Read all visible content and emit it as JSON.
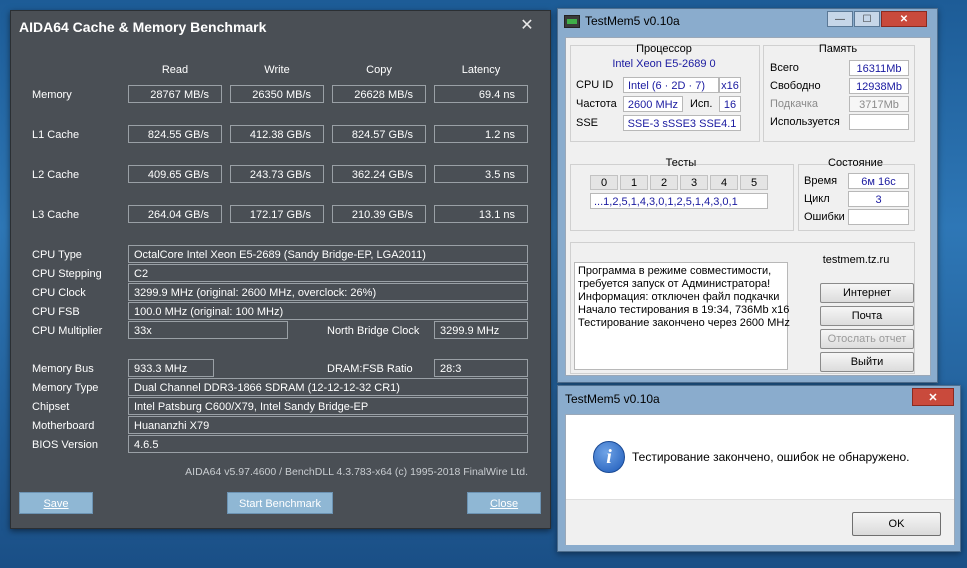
{
  "aida": {
    "title": "AIDA64 Cache & Memory Benchmark",
    "columns": [
      "Read",
      "Write",
      "Copy",
      "Latency"
    ],
    "bench_rows": [
      {
        "label": "Memory",
        "read": "28767 MB/s",
        "write": "26350 MB/s",
        "copy": "26628 MB/s",
        "latency": "69.4 ns"
      },
      {
        "label": "L1 Cache",
        "read": "824.55 GB/s",
        "write": "412.38 GB/s",
        "copy": "824.57 GB/s",
        "latency": "1.2 ns"
      },
      {
        "label": "L2 Cache",
        "read": "409.65 GB/s",
        "write": "243.73 GB/s",
        "copy": "362.24 GB/s",
        "latency": "3.5 ns"
      },
      {
        "label": "L3 Cache",
        "read": "264.04 GB/s",
        "write": "172.17 GB/s",
        "copy": "210.39 GB/s",
        "latency": "13.1 ns"
      }
    ],
    "cpu_type_label": "CPU Type",
    "cpu_type": "OctalCore Intel Xeon E5-2689  (Sandy Bridge-EP, LGA2011)",
    "cpu_stepping_label": "CPU Stepping",
    "cpu_stepping": "C2",
    "cpu_clock_label": "CPU Clock",
    "cpu_clock": "3299.9 MHz  (original: 2600 MHz, overclock: 26%)",
    "cpu_fsb_label": "CPU FSB",
    "cpu_fsb": "100.0 MHz  (original: 100 MHz)",
    "cpu_mult_label": "CPU Multiplier",
    "cpu_mult": "33x",
    "nb_clock_label": "North Bridge Clock",
    "nb_clock": "3299.9 MHz",
    "mem_bus_label": "Memory Bus",
    "mem_bus": "933.3 MHz",
    "dram_ratio_label": "DRAM:FSB Ratio",
    "dram_ratio": "28:3",
    "mem_type_label": "Memory Type",
    "mem_type": "Dual Channel DDR3-1866 SDRAM  (12-12-12-32 CR1)",
    "chipset_label": "Chipset",
    "chipset": "Intel Patsburg C600/X79, Intel Sandy Bridge-EP",
    "mobo_label": "Motherboard",
    "mobo": "Huananzhi X79",
    "bios_label": "BIOS Version",
    "bios": "4.6.5",
    "footer": "AIDA64 v5.97.4600 / BenchDLL 4.3.783-x64  (c) 1995-2018 FinalWire Ltd.",
    "btn_save": "Save",
    "btn_start": "Start Benchmark",
    "btn_close": "Close",
    "close_glyph": "✕"
  },
  "testmem": {
    "title": "TestMem5 v0.10a",
    "win_min": "—",
    "win_max": "☐",
    "win_close": "✕",
    "cpu_group": "Процессор",
    "cpu_name": "Intel Xeon  E5-2689 0",
    "cpuid_label": "CPU ID",
    "cpuid": "Intel  (6 · 2D · 7)",
    "cpuid_threads": "x16",
    "freq_label": "Частота",
    "freq": "2600 MHz",
    "used_label": "Исп.",
    "used": "16",
    "sse_label": "SSE",
    "sse": "SSE-3 sSSE3 SSE4.1",
    "mem_group": "Память",
    "total_label": "Всего",
    "total": "16311Mb",
    "free_label": "Свободно",
    "free": "12938Mb",
    "swap_label": "Подкачка",
    "swap": "3717Mb",
    "inuse_label": "Используется",
    "inuse": "",
    "tests_group": "Тесты",
    "tests": [
      "0",
      "1",
      "2",
      "3",
      "4",
      "5"
    ],
    "tests_seq": "...1,2,5,1,4,3,0,1,2,5,1,4,3,0,1",
    "state_group": "Состояние",
    "time_label": "Время",
    "time": "6м 16с",
    "cycle_label": "Цикл",
    "cycle": "3",
    "errors_label": "Ошибки",
    "errors": "",
    "log": [
      "Программа в режиме совместимости,",
      "требуется запуск от Администратора!",
      "Информация: отключен файл подкачки",
      "Начало тестирования в 19:34, 736Mb x16",
      "Тестирование закончено через 2600 MHz"
    ],
    "site": "testmem.tz.ru",
    "btn_internet": "Интернет",
    "btn_mail": "Почта",
    "btn_report": "Отослать отчет",
    "btn_exit": "Выйти"
  },
  "dialog": {
    "title": "TestMem5 v0.10a",
    "close": "✕",
    "info_glyph": "i",
    "message": "Тестирование закончено, ошибок не обнаружено.",
    "ok": "OK"
  }
}
